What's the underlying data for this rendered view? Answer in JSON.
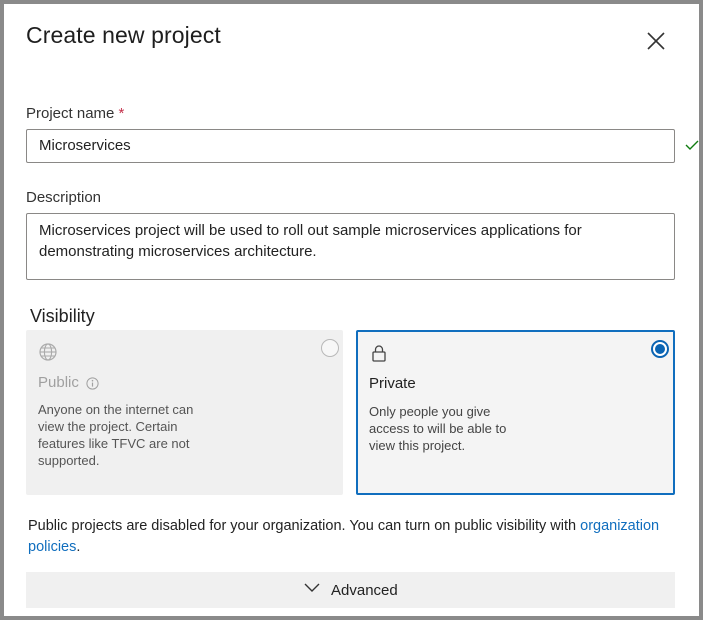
{
  "dialog": {
    "title": "Create new project",
    "close_icon": "close-icon"
  },
  "project_name": {
    "label": "Project name",
    "required_marker": "*",
    "value": "Microservices",
    "valid_icon": "checkmark-icon",
    "valid_color": "#107c10"
  },
  "description": {
    "label": "Description",
    "value": "Microservices project will be used to roll out sample microservices applications for demonstrating microservices architecture."
  },
  "visibility": {
    "label": "Visibility",
    "options": [
      {
        "key": "public",
        "icon": "globe-icon",
        "title": "Public",
        "info_icon": "info-icon",
        "description": "Anyone on the internet can view the project. Certain features like TFVC are not supported.",
        "selected": false,
        "disabled": true
      },
      {
        "key": "private",
        "icon": "lock-icon",
        "title": "Private",
        "description": "Only people you give access to will be able to view this project.",
        "selected": true,
        "disabled": false
      }
    ],
    "accent_color": "#106ebe"
  },
  "notice": {
    "text": "Public projects are disabled for your organization. You can turn on public visibility with",
    "link": "organization policies",
    "suffix": "."
  },
  "advanced": {
    "label": "Advanced",
    "icon": "chevron-down-icon"
  }
}
